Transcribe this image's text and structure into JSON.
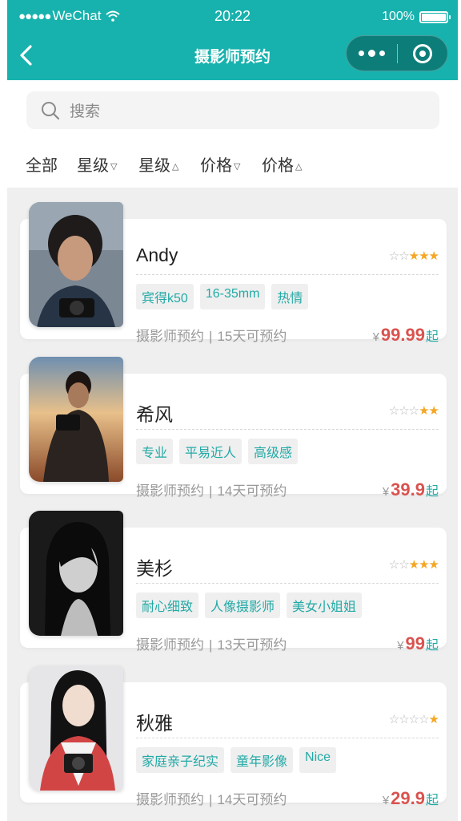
{
  "status_bar": {
    "carrier": "WeChat",
    "time": "20:22",
    "battery": "100%"
  },
  "nav": {
    "title": "摄影师预约"
  },
  "search": {
    "placeholder": "搜索"
  },
  "filters": [
    {
      "label": "全部",
      "arrow": ""
    },
    {
      "label": "星级",
      "arrow": "▽"
    },
    {
      "label": "星级",
      "arrow": "△"
    },
    {
      "label": "价格",
      "arrow": "▽"
    },
    {
      "label": "价格",
      "arrow": "△"
    }
  ],
  "colors": {
    "brand": "#17b2ad",
    "price": "#d9534f",
    "star": "#f5a623",
    "tag_text": "#22aaa6"
  },
  "photographers": [
    {
      "name": "Andy",
      "rating": 3,
      "tags": [
        "宾得k50",
        "16-35mm",
        "热情"
      ],
      "category": "摄影师预约",
      "availability": "15天可预约",
      "currency": "¥",
      "price": "99.99",
      "price_suffix": "起"
    },
    {
      "name": "希风",
      "rating": 2,
      "tags": [
        "专业",
        "平易近人",
        "高级感"
      ],
      "category": "摄影师预约",
      "availability": "14天可预约",
      "currency": "¥",
      "price": "39.9",
      "price_suffix": "起"
    },
    {
      "name": "美杉",
      "rating": 3,
      "tags": [
        "耐心细致",
        "人像摄影师",
        "美女小姐姐"
      ],
      "category": "摄影师预约",
      "availability": "13天可预约",
      "currency": "¥",
      "price": "99",
      "price_suffix": "起"
    },
    {
      "name": "秋雅",
      "rating": 1,
      "tags": [
        "家庭亲子纪实",
        "童年影像",
        "Nice"
      ],
      "category": "摄影师预约",
      "availability": "14天可预约",
      "currency": "¥",
      "price": "29.9",
      "price_suffix": "起"
    }
  ]
}
